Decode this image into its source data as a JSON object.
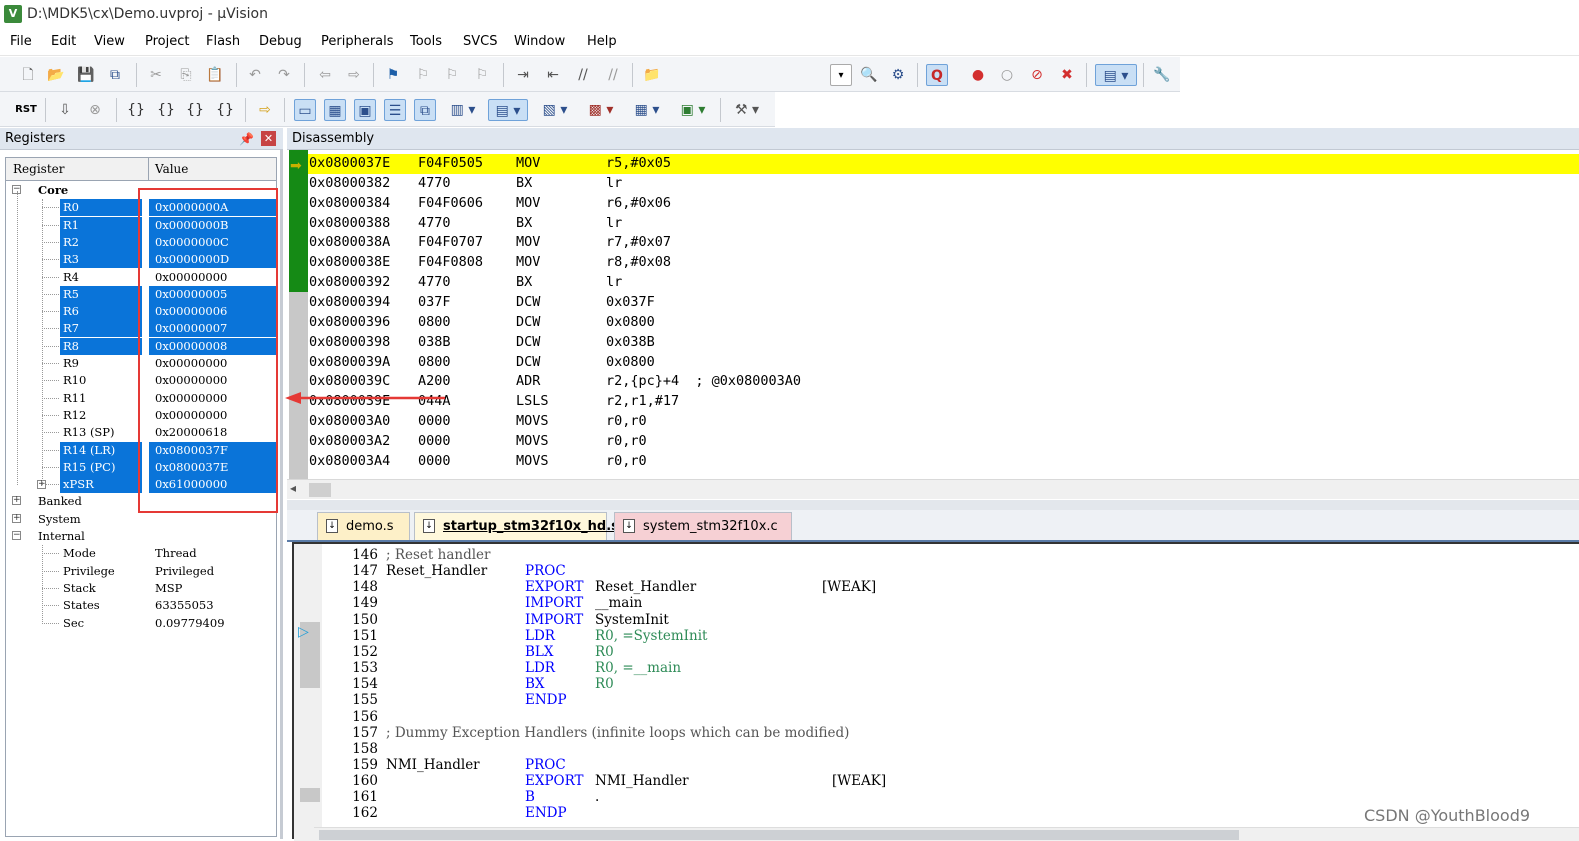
{
  "window": {
    "title": "D:\\MDK5\\cx\\Demo.uvproj - µVision",
    "app_icon": "V"
  },
  "menu": [
    "File",
    "Edit",
    "View",
    "Project",
    "Flash",
    "Debug",
    "Peripherals",
    "Tools",
    "SVCS",
    "Window",
    "Help"
  ],
  "registers": {
    "panel_title": "Registers",
    "col_register": "Register",
    "col_value": "Value",
    "core_label": "Core",
    "core": [
      {
        "name": "R0",
        "value": "0x0000000A",
        "selected": true
      },
      {
        "name": "R1",
        "value": "0x0000000B",
        "selected": true
      },
      {
        "name": "R2",
        "value": "0x0000000C",
        "selected": true
      },
      {
        "name": "R3",
        "value": "0x0000000D",
        "selected": true
      },
      {
        "name": "R4",
        "value": "0x00000000",
        "selected": false
      },
      {
        "name": "R5",
        "value": "0x00000005",
        "selected": true
      },
      {
        "name": "R6",
        "value": "0x00000006",
        "selected": true
      },
      {
        "name": "R7",
        "value": "0x00000007",
        "selected": true
      },
      {
        "name": "R8",
        "value": "0x00000008",
        "selected": true
      },
      {
        "name": "R9",
        "value": "0x00000000",
        "selected": false
      },
      {
        "name": "R10",
        "value": "0x00000000",
        "selected": false
      },
      {
        "name": "R11",
        "value": "0x00000000",
        "selected": false
      },
      {
        "name": "R12",
        "value": "0x00000000",
        "selected": false
      },
      {
        "name": "R13 (SP)",
        "value": "0x20000618",
        "selected": false
      },
      {
        "name": "R14 (LR)",
        "value": "0x0800037F",
        "selected": true
      },
      {
        "name": "R15 (PC)",
        "value": "0x0800037E",
        "selected": true
      },
      {
        "name": "xPSR",
        "value": "0x61000000",
        "selected": true
      }
    ],
    "banked_label": "Banked",
    "system_label": "System",
    "internal_label": "Internal",
    "internal": [
      {
        "name": "Mode",
        "value": "Thread"
      },
      {
        "name": "Privilege",
        "value": "Privileged"
      },
      {
        "name": "Stack",
        "value": "MSP"
      },
      {
        "name": "States",
        "value": "63355053"
      },
      {
        "name": "Sec",
        "value": "0.09779409"
      }
    ]
  },
  "disassembly": {
    "panel_title": "Disassembly",
    "rows": [
      {
        "addr": "0x0800037E",
        "code": "F04F0505",
        "op": "MOV",
        "args": "r5,#0x05",
        "current": true
      },
      {
        "addr": "0x08000382",
        "code": "4770",
        "op": "BX",
        "args": "lr"
      },
      {
        "addr": "0x08000384",
        "code": "F04F0606",
        "op": "MOV",
        "args": "r6,#0x06"
      },
      {
        "addr": "0x08000388",
        "code": "4770",
        "op": "BX",
        "args": "lr"
      },
      {
        "addr": "0x0800038A",
        "code": "F04F0707",
        "op": "MOV",
        "args": "r7,#0x07"
      },
      {
        "addr": "0x0800038E",
        "code": "F04F0808",
        "op": "MOV",
        "args": "r8,#0x08"
      },
      {
        "addr": "0x08000392",
        "code": "4770",
        "op": "BX",
        "args": "lr"
      },
      {
        "addr": "0x08000394",
        "code": "037F",
        "op": "DCW",
        "args": "0x037F"
      },
      {
        "addr": "0x08000396",
        "code": "0800",
        "op": "DCW",
        "args": "0x0800"
      },
      {
        "addr": "0x08000398",
        "code": "038B",
        "op": "DCW",
        "args": "0x038B"
      },
      {
        "addr": "0x0800039A",
        "code": "0800",
        "op": "DCW",
        "args": "0x0800"
      },
      {
        "addr": "0x0800039C",
        "code": "A200",
        "op": "ADR",
        "args": "r2,{pc}+4  ; @0x080003A0"
      },
      {
        "addr": "0x0800039E",
        "code": "044A",
        "op": "LSLS",
        "args": "r2,r1,#17"
      },
      {
        "addr": "0x080003A0",
        "code": "0000",
        "op": "MOVS",
        "args": "r0,r0"
      },
      {
        "addr": "0x080003A2",
        "code": "0000",
        "op": "MOVS",
        "args": "r0,r0"
      },
      {
        "addr": "0x080003A4",
        "code": "0000",
        "op": "MOVS",
        "args": "r0,r0"
      }
    ]
  },
  "tabs": [
    {
      "label": "demo.s"
    },
    {
      "label": "startup_stm32f10x_hd.s"
    },
    {
      "label": "system_stm32f10x.c"
    }
  ],
  "editor": {
    "lines": [
      {
        "num": "146",
        "label": "",
        "op": "",
        "arg": "",
        "extra": "",
        "comment": "; Reset handler"
      },
      {
        "num": "147",
        "label": "Reset_Handler",
        "op": "PROC",
        "arg": "",
        "extra": "",
        "comment": ""
      },
      {
        "num": "148",
        "label": "",
        "op": "EXPORT",
        "arg": "Reset_Handler",
        "extra": "[WEAK]",
        "comment": ""
      },
      {
        "num": "149",
        "label": "",
        "op": "IMPORT",
        "arg": "__main",
        "extra": "",
        "comment": ""
      },
      {
        "num": "150",
        "label": "",
        "op": "IMPORT",
        "arg": "SystemInit",
        "extra": "",
        "comment": ""
      },
      {
        "num": "151",
        "label": "",
        "op": "LDR",
        "arg": "R0, =SystemInit",
        "extra": "",
        "comment": ""
      },
      {
        "num": "152",
        "label": "",
        "op": "BLX",
        "arg": "R0",
        "extra": "",
        "comment": ""
      },
      {
        "num": "153",
        "label": "",
        "op": "LDR",
        "arg": "R0, =__main",
        "extra": "",
        "comment": ""
      },
      {
        "num": "154",
        "label": "",
        "op": "BX",
        "arg": "R0",
        "extra": "",
        "comment": ""
      },
      {
        "num": "155",
        "label": "",
        "op": "ENDP",
        "arg": "",
        "extra": "",
        "comment": ""
      },
      {
        "num": "156",
        "label": "",
        "op": "",
        "arg": "",
        "extra": "",
        "comment": ""
      },
      {
        "num": "157",
        "label": "",
        "op": "",
        "arg": "",
        "extra": "",
        "comment": "; Dummy Exception Handlers (infinite loops which can be modified)"
      },
      {
        "num": "158",
        "label": "",
        "op": "",
        "arg": "",
        "extra": "",
        "comment": ""
      },
      {
        "num": "159",
        "label": "NMI_Handler",
        "op": "PROC",
        "arg": "",
        "extra": "",
        "comment": ""
      },
      {
        "num": "160",
        "label": "",
        "op": "EXPORT",
        "arg": "NMI_Handler",
        "extra": "[WEAK]",
        "comment": ""
      },
      {
        "num": "161",
        "label": "",
        "op": "B",
        "arg": ".",
        "extra": "",
        "comment": ""
      },
      {
        "num": "162",
        "label": "",
        "op": "ENDP",
        "arg": "",
        "extra": "",
        "comment": ""
      }
    ]
  },
  "watermark": "CSDN @YouthBlood9",
  "colors": {
    "selection": "#0a74d9",
    "current_line": "#ffff00",
    "annotation": "#e53935",
    "keyword": "#0000ff"
  }
}
